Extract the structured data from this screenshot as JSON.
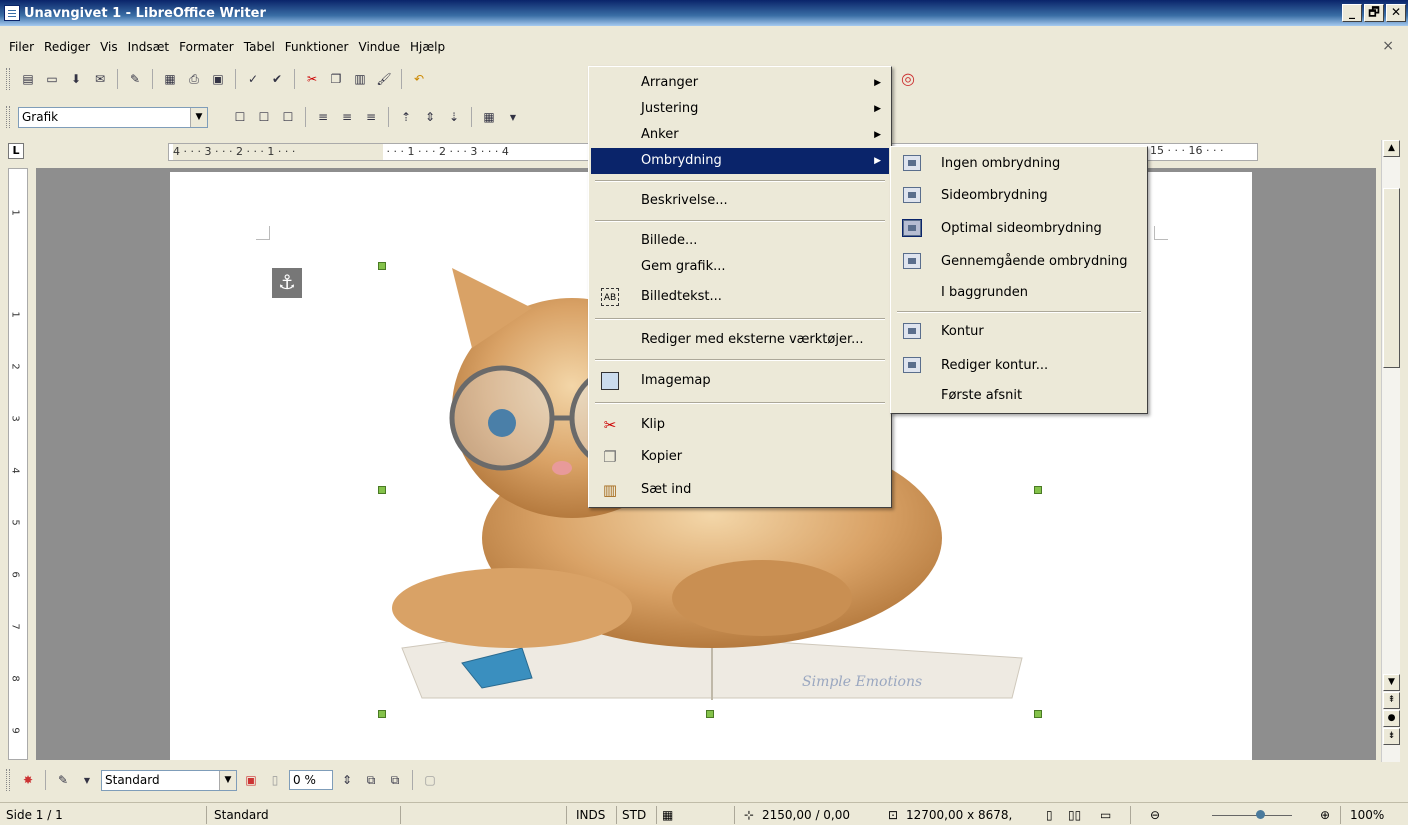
{
  "window": {
    "title": "Unavngivet 1 - LibreOffice Writer",
    "controls": [
      "_",
      "🗗",
      "✕"
    ]
  },
  "menubar": {
    "items": [
      "Filer",
      "Rediger",
      "Vis",
      "Indsæt",
      "Formater",
      "Tabel",
      "Funktioner",
      "Vindue",
      "Hjælp"
    ],
    "close_label": "×"
  },
  "toolbar2": {
    "style_combo": "Grafik"
  },
  "ruler": {
    "left_ticks": "4 · · · 3 · · · 2 · · · 1 · · ·",
    "mid_ticks": "· · · 1 · · · 2 · · · 3 · · · 4",
    "right_ticks": "15 · · · 16 · · ·"
  },
  "vruler_ticks": [
    "1",
    "1",
    "2",
    "3",
    "4",
    "5",
    "6",
    "7",
    "8",
    "9"
  ],
  "context_menu": {
    "items": [
      {
        "label": "Arranger",
        "submenu": true,
        "icon": ""
      },
      {
        "label": "Justering",
        "submenu": true,
        "icon": ""
      },
      {
        "label": "Anker",
        "submenu": true,
        "icon": ""
      },
      {
        "label": "Ombrydning",
        "submenu": true,
        "icon": "",
        "highlighted": true
      },
      {
        "label": "Beskrivelse...",
        "icon": ""
      },
      {
        "label": "Billede...",
        "icon": ""
      },
      {
        "label": "Gem grafik...",
        "icon": ""
      },
      {
        "label": "Billedtekst...",
        "icon": "caption-icon"
      },
      {
        "label": "Rediger med eksterne værktøjer...",
        "icon": ""
      },
      {
        "label": "Imagemap",
        "icon": "imagemap-icon"
      },
      {
        "label": "Klip",
        "icon": "scissors-icon"
      },
      {
        "label": "Kopier",
        "icon": "copy-icon"
      },
      {
        "label": "Sæt ind",
        "icon": "paste-icon"
      }
    ]
  },
  "submenu": {
    "items": [
      {
        "label": "Ingen ombrydning",
        "icon": "wrap-none-icon"
      },
      {
        "label": "Sideombrydning",
        "icon": "wrap-page-icon"
      },
      {
        "label": "Optimal sideombrydning",
        "icon": "wrap-optimal-icon",
        "selected": true
      },
      {
        "label": "Gennemgående ombrydning",
        "icon": "wrap-through-icon"
      },
      {
        "label": "I baggrunden",
        "icon": ""
      },
      {
        "label": "Kontur",
        "icon": "contour-icon"
      },
      {
        "label": "Rediger kontur...",
        "icon": "edit-contour-icon"
      },
      {
        "label": "Første afsnit",
        "icon": ""
      }
    ]
  },
  "image": {
    "watermark": "Simple Emotions"
  },
  "bottom_toolbar": {
    "style_combo": "Standard",
    "transparency": "0 %"
  },
  "statusbar": {
    "page": "Side 1 / 1",
    "style": "Standard",
    "mode_ins": "INDS",
    "mode_sel": "STD",
    "position": "2150,00 / 0,00",
    "size": "12700,00 x 8678,",
    "zoom": "100%"
  },
  "colors": {
    "menu_highlight": "#0a246a",
    "handle": "#84c24a",
    "doc_background": "#8e8e8e"
  }
}
